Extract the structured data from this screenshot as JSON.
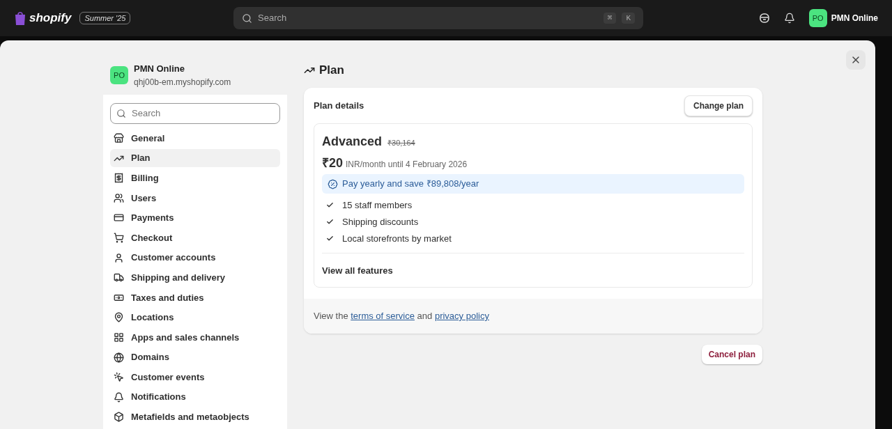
{
  "topbar": {
    "logo_text": "shopify",
    "edition_badge": "Summer '25",
    "search": {
      "placeholder": "Search",
      "shortcut_keys": [
        "⌘",
        "K"
      ]
    },
    "store": {
      "initials": "PO",
      "name": "PMN Online"
    }
  },
  "sidebar": {
    "store": {
      "initials": "PO",
      "name": "PMN Online",
      "domain": "qhj00b-em.myshopify.com"
    },
    "search": {
      "placeholder": "Search"
    },
    "items": [
      {
        "label": "General",
        "selected": false
      },
      {
        "label": "Plan",
        "selected": true
      },
      {
        "label": "Billing",
        "selected": false
      },
      {
        "label": "Users",
        "selected": false
      },
      {
        "label": "Payments",
        "selected": false
      },
      {
        "label": "Checkout",
        "selected": false
      },
      {
        "label": "Customer accounts",
        "selected": false
      },
      {
        "label": "Shipping and delivery",
        "selected": false
      },
      {
        "label": "Taxes and duties",
        "selected": false
      },
      {
        "label": "Locations",
        "selected": false
      },
      {
        "label": "Apps and sales channels",
        "selected": false
      },
      {
        "label": "Domains",
        "selected": false
      },
      {
        "label": "Customer events",
        "selected": false
      },
      {
        "label": "Notifications",
        "selected": false
      },
      {
        "label": "Metafields and metaobjects",
        "selected": false
      }
    ]
  },
  "page": {
    "title": "Plan",
    "plan_details": {
      "heading": "Plan details",
      "change_button": "Change plan",
      "plan_name": "Advanced",
      "old_price": "₹30,164",
      "price": "₹20",
      "price_note": "INR/month until 4 February 2026",
      "promo": "Pay yearly and save ₹89,808/year",
      "features": [
        "15 staff members",
        "Shipping discounts",
        "Local storefronts by market"
      ],
      "view_all": "View all features"
    },
    "footer": {
      "parts": [
        {
          "kind": "text",
          "text": "View the "
        },
        {
          "kind": "link",
          "text": "terms of service"
        },
        {
          "kind": "text",
          "text": " and "
        },
        {
          "kind": "link",
          "text": "privacy policy"
        }
      ]
    },
    "cancel_button": "Cancel plan"
  }
}
